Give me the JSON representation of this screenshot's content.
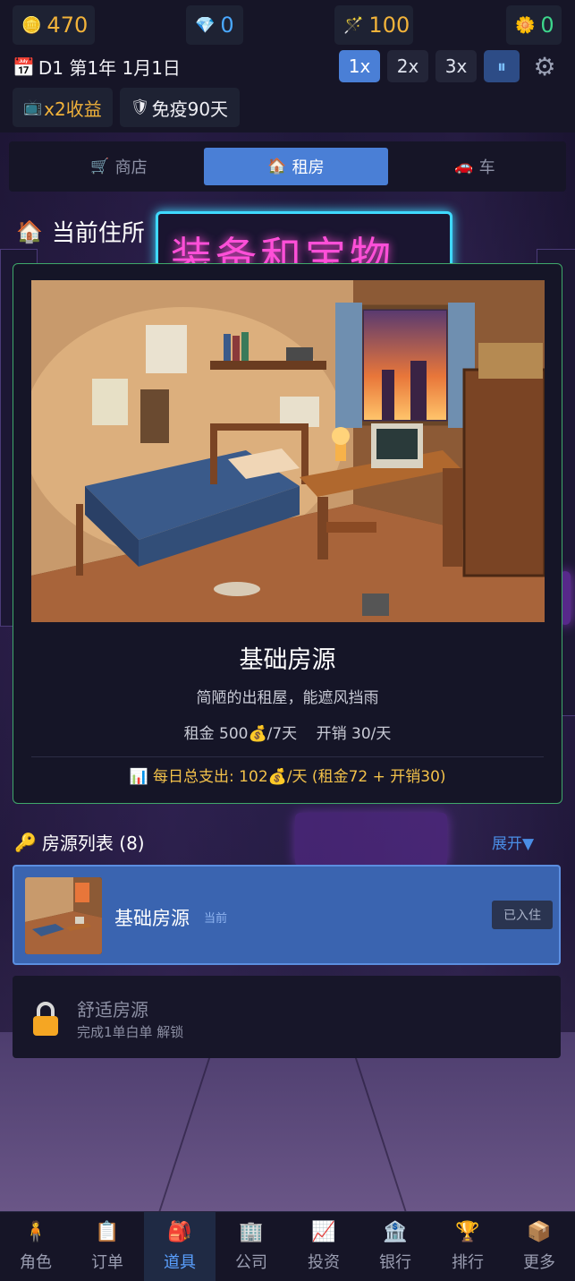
{
  "topbar": {
    "gold": "470",
    "diamond": "0",
    "wand": "100",
    "coin": "0",
    "date": "D1 第1年 1月1日",
    "speeds": [
      "1x",
      "2x",
      "3x"
    ],
    "pause": "⏸",
    "buffs": [
      "x2收益",
      "免疫90天"
    ]
  },
  "tabs": [
    {
      "icon": "🛒",
      "label": "商店"
    },
    {
      "icon": "🏠",
      "label": "租房"
    },
    {
      "icon": "🚗",
      "label": "车"
    }
  ],
  "current": {
    "section_title": "当前住所",
    "sign_text": "装备和宝物",
    "name": "基础房源",
    "desc": "简陋的出租屋，能遮风挡雨",
    "rent": "租金 500💰/7天",
    "upkeep": "开销 30/天",
    "total": "📊 每日总支出: 102💰/天 (租金72 + 开销30)"
  },
  "list": {
    "title": "房源列表 (8)",
    "expand": "展开▼",
    "items": [
      {
        "name": "基础房源",
        "tag": "当前",
        "status": "已入住"
      },
      {
        "name": "舒适房源",
        "hint": "完成1单白单 解锁"
      }
    ]
  },
  "nav": [
    {
      "icon": "🧍",
      "label": "角色"
    },
    {
      "icon": "📋",
      "label": "订单"
    },
    {
      "icon": "🎒",
      "label": "道具"
    },
    {
      "icon": "🏢",
      "label": "公司"
    },
    {
      "icon": "📈",
      "label": "投资"
    },
    {
      "icon": "🏦",
      "label": "银行"
    },
    {
      "icon": "🏆",
      "label": "排行"
    },
    {
      "icon": "📦",
      "label": "更多"
    }
  ],
  "colors": {
    "accent": "#4a7fd6",
    "gold": "#f2b33a",
    "card_border": "#3fa86a",
    "neon_pink": "#ff4fd8",
    "neon_cyan": "#3fd9ff"
  }
}
